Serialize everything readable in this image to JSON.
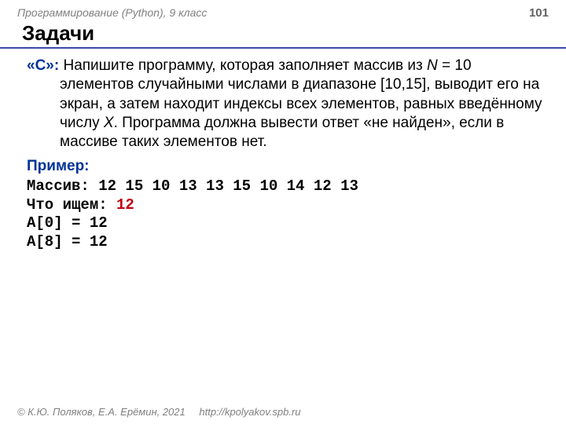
{
  "header": {
    "course": "Программирование (Python), 9 класс",
    "page_num": "101"
  },
  "title": "Задачи",
  "task": {
    "label": "«C»:",
    "text_before_n": " Напишите программу, которая заполняет массив из ",
    "n_var": "N",
    "text_after_n": " = 10 элементов случайными числами в диапазоне [10,15], выводит его на экран, а затем находит индексы всех элементов, равных введённому числу ",
    "x_var": "X",
    "text_after_x": ". Программа должна вывести ответ «не найден», если в массиве таких элементов нет."
  },
  "example": {
    "label": "Пример:",
    "array_line": "Массив: 12 15 10 13 13 15 10 14 12 13",
    "search_prefix": "Что ищем: ",
    "search_value": "12",
    "result1": "A[0] = 12",
    "result2": "A[8] = 12"
  },
  "footer": {
    "copyright": "© К.Ю. Поляков, Е.А. Ерёмин, 2021",
    "url": "http://kpolyakov.spb.ru"
  }
}
